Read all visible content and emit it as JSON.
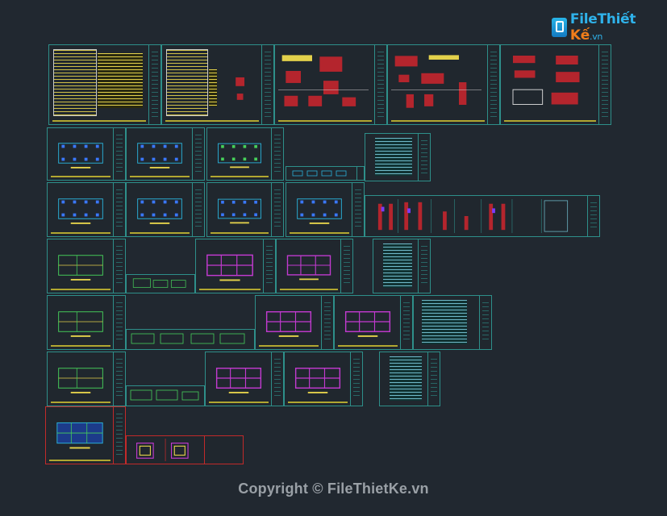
{
  "watermark": {
    "logo_icon": "document-icon",
    "brand_main": "File",
    "brand_mid": "Thiết ",
    "brand_accent": "Kế",
    "brand_suffix": ".vn",
    "brand_color": "#2fb2ea",
    "accent_color": "#f07d1a"
  },
  "footer": {
    "copyright": "Copyright © FileThietKe.vn"
  },
  "drawing": {
    "background_color": "#212830",
    "sheet_border_color": "#2e8f8a",
    "selected_border_color": "#c22a2a",
    "sheet_groups": [
      "general-notes-sheets",
      "foundation-layout-sheets",
      "column-layout-sheets",
      "beam-layout-sheets",
      "floor-plan-sheets",
      "schedule-tables"
    ]
  }
}
